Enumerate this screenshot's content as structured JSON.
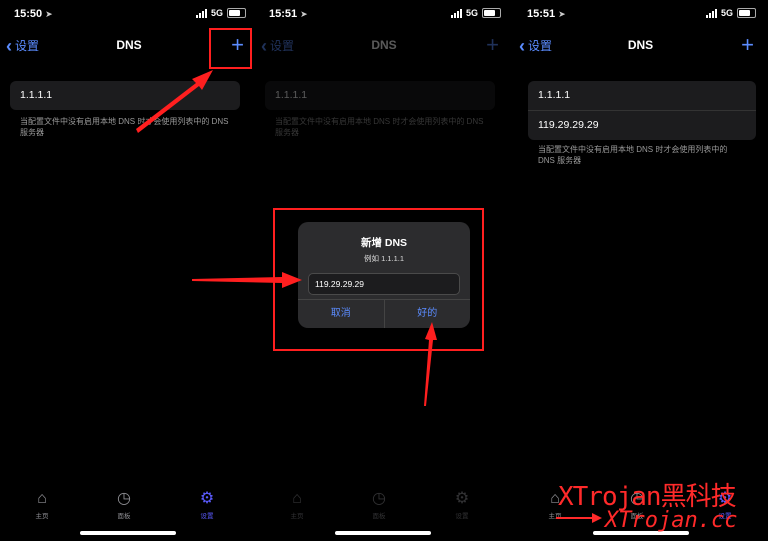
{
  "screens": [
    {
      "status": {
        "time": "15:50",
        "network": "5G"
      },
      "nav": {
        "back_label": "设置",
        "title": "DNS",
        "plus": "+"
      },
      "dns_list": [
        "1.1.1.1"
      ],
      "hint": "当配置文件中没有启用本地 DNS 时才会使用列表中的 DNS 服务器"
    },
    {
      "status": {
        "time": "15:51",
        "network": "5G"
      },
      "nav": {
        "back_label": "设置",
        "title": "DNS",
        "plus": "+"
      },
      "dns_list": [
        "1.1.1.1"
      ],
      "hint": "当配置文件中没有启用本地 DNS 时才会使用列表中的 DNS 服务器",
      "dialog": {
        "title": "新增 DNS",
        "subtitle": "例如 1.1.1.1",
        "input_value": "119.29.29.29",
        "cancel_label": "取消",
        "ok_label": "好的"
      }
    },
    {
      "status": {
        "time": "15:51",
        "network": "5G"
      },
      "nav": {
        "back_label": "设置",
        "title": "DNS",
        "plus": "+"
      },
      "dns_list": [
        "1.1.1.1",
        "119.29.29.29"
      ],
      "hint": "当配置文件中没有启用本地 DNS 时才会使用列表中的 DNS 服务器"
    }
  ],
  "tabbar": {
    "items": [
      {
        "label": "主页",
        "icon": "home-icon"
      },
      {
        "label": "面板",
        "icon": "dashboard-icon"
      },
      {
        "label": "设置",
        "icon": "gear-icon"
      }
    ]
  },
  "watermark": {
    "line1": "XTrojan黑科技",
    "line2": "XTrojan.cc"
  },
  "colors": {
    "accent": "#5b8cff",
    "annotation": "#ff1f1f",
    "background": "#000000"
  }
}
